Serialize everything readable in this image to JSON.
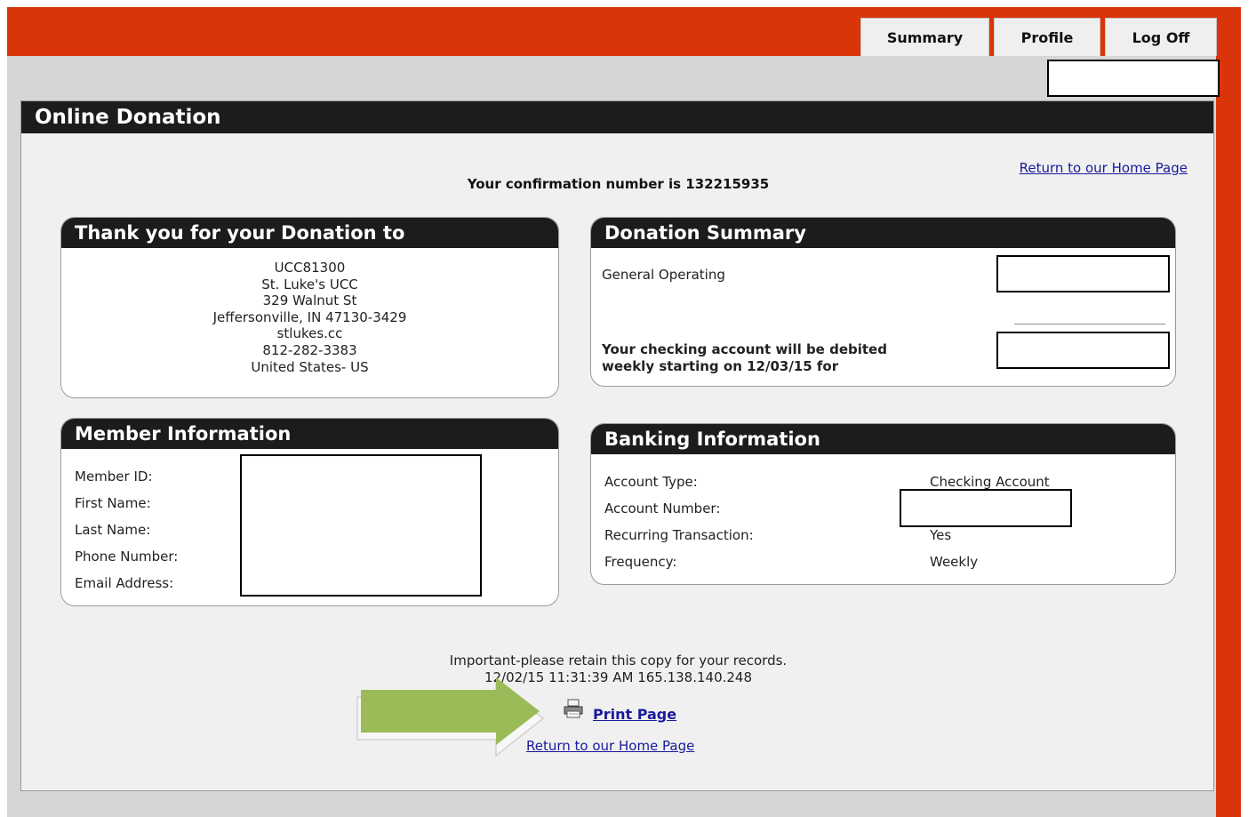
{
  "nav": {
    "tabs": [
      {
        "label": "Summary"
      },
      {
        "label": "Profile"
      },
      {
        "label": "Log Off"
      }
    ]
  },
  "panel": {
    "title": "Online Donation",
    "home_link": "Return to our Home Page",
    "confirmation": "Your confirmation number is 132215935"
  },
  "thank_you": {
    "title": "Thank you for your Donation to",
    "lines": [
      "UCC81300",
      "St. Luke's UCC",
      "329 Walnut St",
      "Jeffersonville, IN 47130-3429",
      "stlukes.cc",
      "812-282-3383",
      "United States- US"
    ]
  },
  "donation_summary": {
    "title": "Donation Summary",
    "item": "General Operating",
    "debit_line1": "Your checking account will be debited",
    "debit_line2": "weekly starting on 12/03/15 for"
  },
  "member_info": {
    "title": "Member Information",
    "labels": [
      "Member ID:",
      "First Name:",
      "Last Name:",
      "Phone Number:",
      "Email Address:"
    ]
  },
  "banking_info": {
    "title": "Banking Information",
    "rows": [
      {
        "label": "Account Type:",
        "value": "Checking Account"
      },
      {
        "label": "Account Number:",
        "value": ""
      },
      {
        "label": "Recurring Transaction:",
        "value": "Yes"
      },
      {
        "label": "Frequency:",
        "value": "Weekly"
      }
    ]
  },
  "footer": {
    "notice": "Important-please retain this copy for your records.",
    "timestamp": "12/02/15 11:31:39 AM 165.138.140.248",
    "print_label": "Print Page",
    "home_link": "Return to our Home Page"
  },
  "colors": {
    "brand_red": "#d9340a",
    "header_dark": "#1c1c1e",
    "arrow_green": "#9bbb59",
    "link_blue": "#1a1a9c"
  },
  "icons": {
    "printer": "printer-icon",
    "arrow": "arrow-right-icon"
  }
}
